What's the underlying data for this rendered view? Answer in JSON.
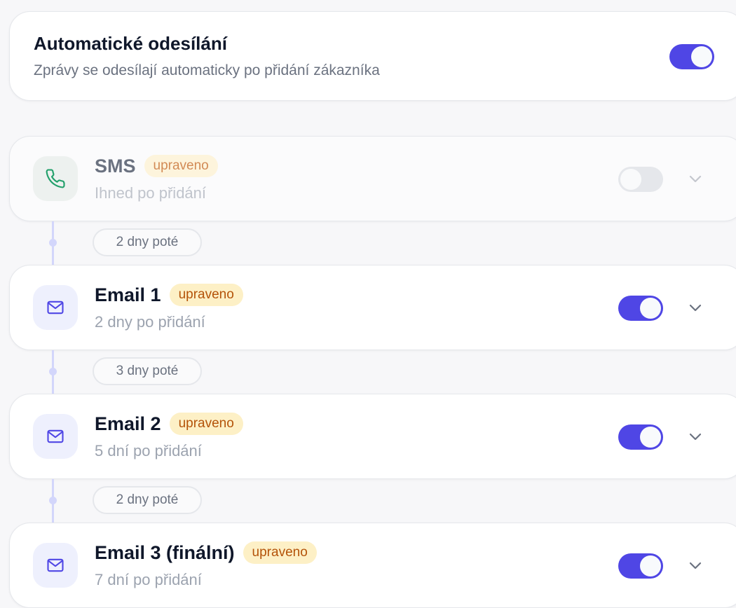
{
  "auto_send": {
    "title": "Automatické odesílání",
    "subtitle": "Zprávy se odesílají automaticky po přidání zákazníka",
    "enabled": true
  },
  "steps": [
    {
      "title": "SMS",
      "badge": "upraveno",
      "subtitle": "Ihned po přidání",
      "icon": "phone-icon",
      "enabled": false
    },
    {
      "title": "Email 1",
      "badge": "upraveno",
      "subtitle": "2 dny po přidání",
      "icon": "mail-icon",
      "enabled": true
    },
    {
      "title": "Email 2",
      "badge": "upraveno",
      "subtitle": "5 dní po přidání",
      "icon": "mail-icon",
      "enabled": true
    },
    {
      "title": "Email 3 (finální)",
      "badge": "upraveno",
      "subtitle": "7 dní po přidání",
      "icon": "mail-icon",
      "enabled": true
    }
  ],
  "delays": [
    {
      "label": "2 dny poté"
    },
    {
      "label": "3 dny poté"
    },
    {
      "label": "2 dny poté"
    }
  ],
  "colors": {
    "accent": "#4f46e5",
    "badge_bg": "#fdf0c6",
    "badge_text": "#b45309",
    "phone_icon": "#22a06b",
    "connector": "#d3d6fb"
  }
}
